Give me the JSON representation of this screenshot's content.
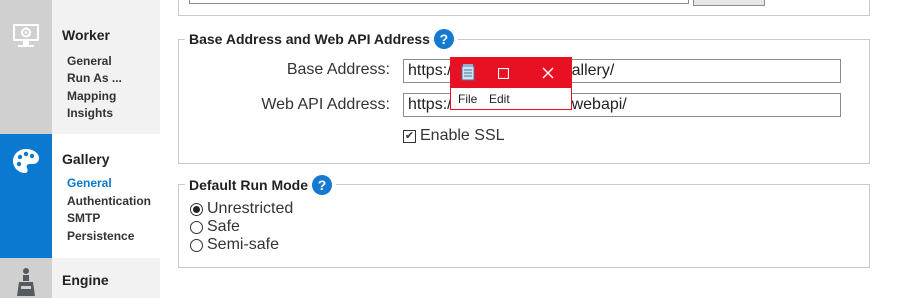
{
  "sidebar": {
    "sections": [
      {
        "title": "Worker",
        "items": [
          "General",
          "Run As ...",
          "Mapping",
          "Insights"
        ]
      },
      {
        "title": "Gallery",
        "items": [
          "General",
          "Authentication",
          "SMTP",
          "Persistence"
        ]
      },
      {
        "title": "Engine"
      }
    ],
    "selected_item": "Gallery > General",
    "colors": {
      "active": "#0a79cf",
      "inactive": "#d0d0d0"
    }
  },
  "base_address_group": {
    "legend": "Base Address and Web API Address",
    "help": "?",
    "base_address_label": "Base Address:",
    "base_address_value": "https://          pro.com/gallery/",
    "web_api_label": "Web API Address:",
    "web_api_value": "https://                    om/webapi/",
    "ssl_label": "Enable SSL",
    "ssl_checked": true
  },
  "run_mode_group": {
    "legend": "Default Run Mode",
    "help": "?",
    "options": [
      "Unrestricted",
      "Safe",
      "Semi-safe"
    ],
    "selected": "Unrestricted"
  },
  "popup": {
    "menu": [
      "File",
      "Edit"
    ],
    "icons": [
      "notepad-icon",
      "maximize-icon",
      "close-icon"
    ],
    "color": "#e81123"
  }
}
